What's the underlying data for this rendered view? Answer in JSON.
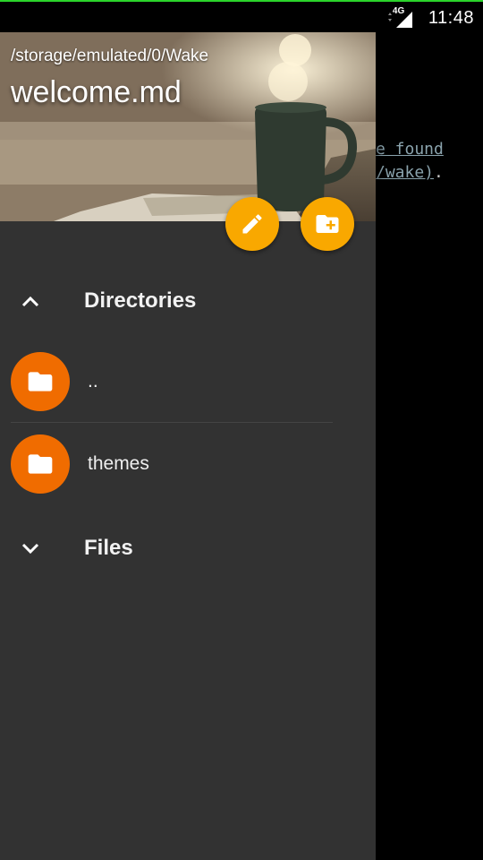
{
  "status_bar": {
    "network_type": "4G",
    "time": "11:48"
  },
  "background_editor": {
    "line1_fragment": "e found",
    "line2_fragment": "/wake)",
    "line2_trailing": "."
  },
  "drawer": {
    "header": {
      "path": "/storage/emulated/0/Wake",
      "title": "welcome.md"
    },
    "fabs": {
      "edit_icon": "pencil-icon",
      "new_folder_icon": "create-new-folder-icon"
    },
    "sections": {
      "directories": {
        "title": "Directories",
        "expanded": true,
        "items": [
          {
            "label": ".."
          },
          {
            "label": "themes"
          }
        ]
      },
      "files": {
        "title": "Files",
        "expanded": false
      }
    }
  },
  "colors": {
    "drawer_bg": "#323232",
    "fab": "#f9a800",
    "folder_circle": "#f06c00",
    "status_accent": "#2bd42b",
    "link_text": "#8aa3ad"
  }
}
